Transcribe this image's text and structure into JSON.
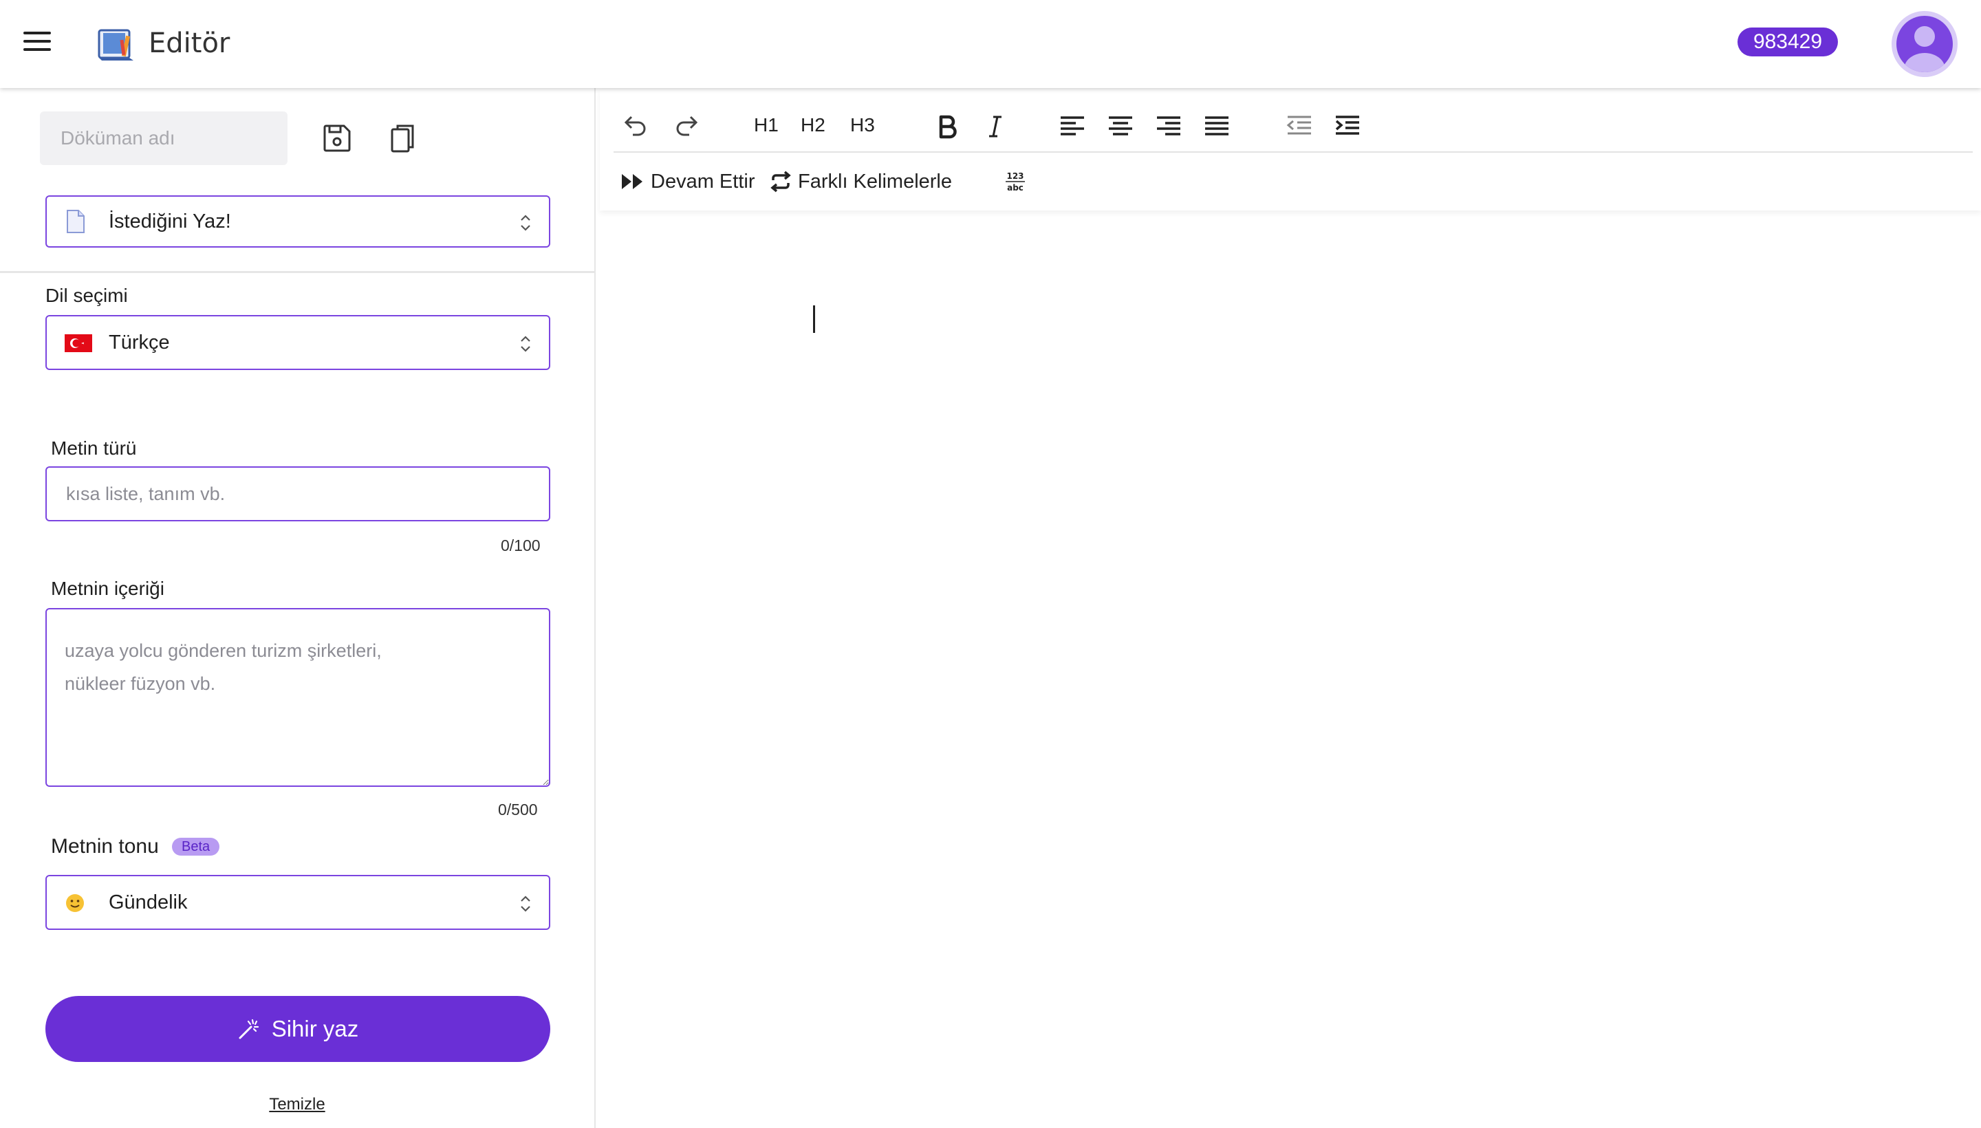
{
  "header": {
    "menu_icon": "hamburger-menu-icon",
    "logo_icon": "book-logo-icon",
    "title": "Editör",
    "credit_count": "983429",
    "avatar_icon": "user-avatar-icon"
  },
  "sidebar": {
    "document_name": {
      "value": "",
      "placeholder": "Döküman adı"
    },
    "save_icon": "save-icon",
    "copy_icon": "copy-icon",
    "template_select": {
      "icon": "document-icon",
      "value": "İstediğini Yaz!"
    },
    "language": {
      "label": "Dil seçimi",
      "flag_icon": "turkey-flag-icon",
      "value": "Türkçe"
    },
    "text_type": {
      "label": "Metin türü",
      "value": "",
      "placeholder": "kısa liste, tanım vb.",
      "counter": "0/100"
    },
    "text_content": {
      "label": "Metnin içeriği",
      "value": "",
      "placeholder": "uzaya yolcu gönderen turizm şirketleri,\nnükleer füzyon vb.",
      "counter": "0/500"
    },
    "tone": {
      "label": "Metnin tonu",
      "beta_badge": "Beta",
      "icon": "smiley-emoji-icon",
      "value": "Gündelik"
    },
    "magic_button": {
      "icon": "magic-wand-icon",
      "label": "Sihir yaz"
    },
    "clear_link": "Temizle"
  },
  "toolbar": {
    "undo_icon": "undo-icon",
    "redo_icon": "redo-icon",
    "h1": "H1",
    "h2": "H2",
    "h3": "H3",
    "bold_icon": "bold-icon",
    "italic_icon": "italic-icon",
    "align_left_icon": "align-left-icon",
    "align_center_icon": "align-center-icon",
    "align_right_icon": "align-right-icon",
    "align_justify_icon": "align-justify-icon",
    "outdent_icon": "outdent-icon",
    "indent_icon": "indent-icon",
    "continue_label": "Devam Ettir",
    "rephrase_label": "Farklı Kelimelerle",
    "spellcheck_icon": "spellcheck-123-abc-icon"
  },
  "colors": {
    "accent": "#6a2fd6",
    "border_accent": "#7b45e0",
    "beta_bg": "#b89bf2"
  }
}
